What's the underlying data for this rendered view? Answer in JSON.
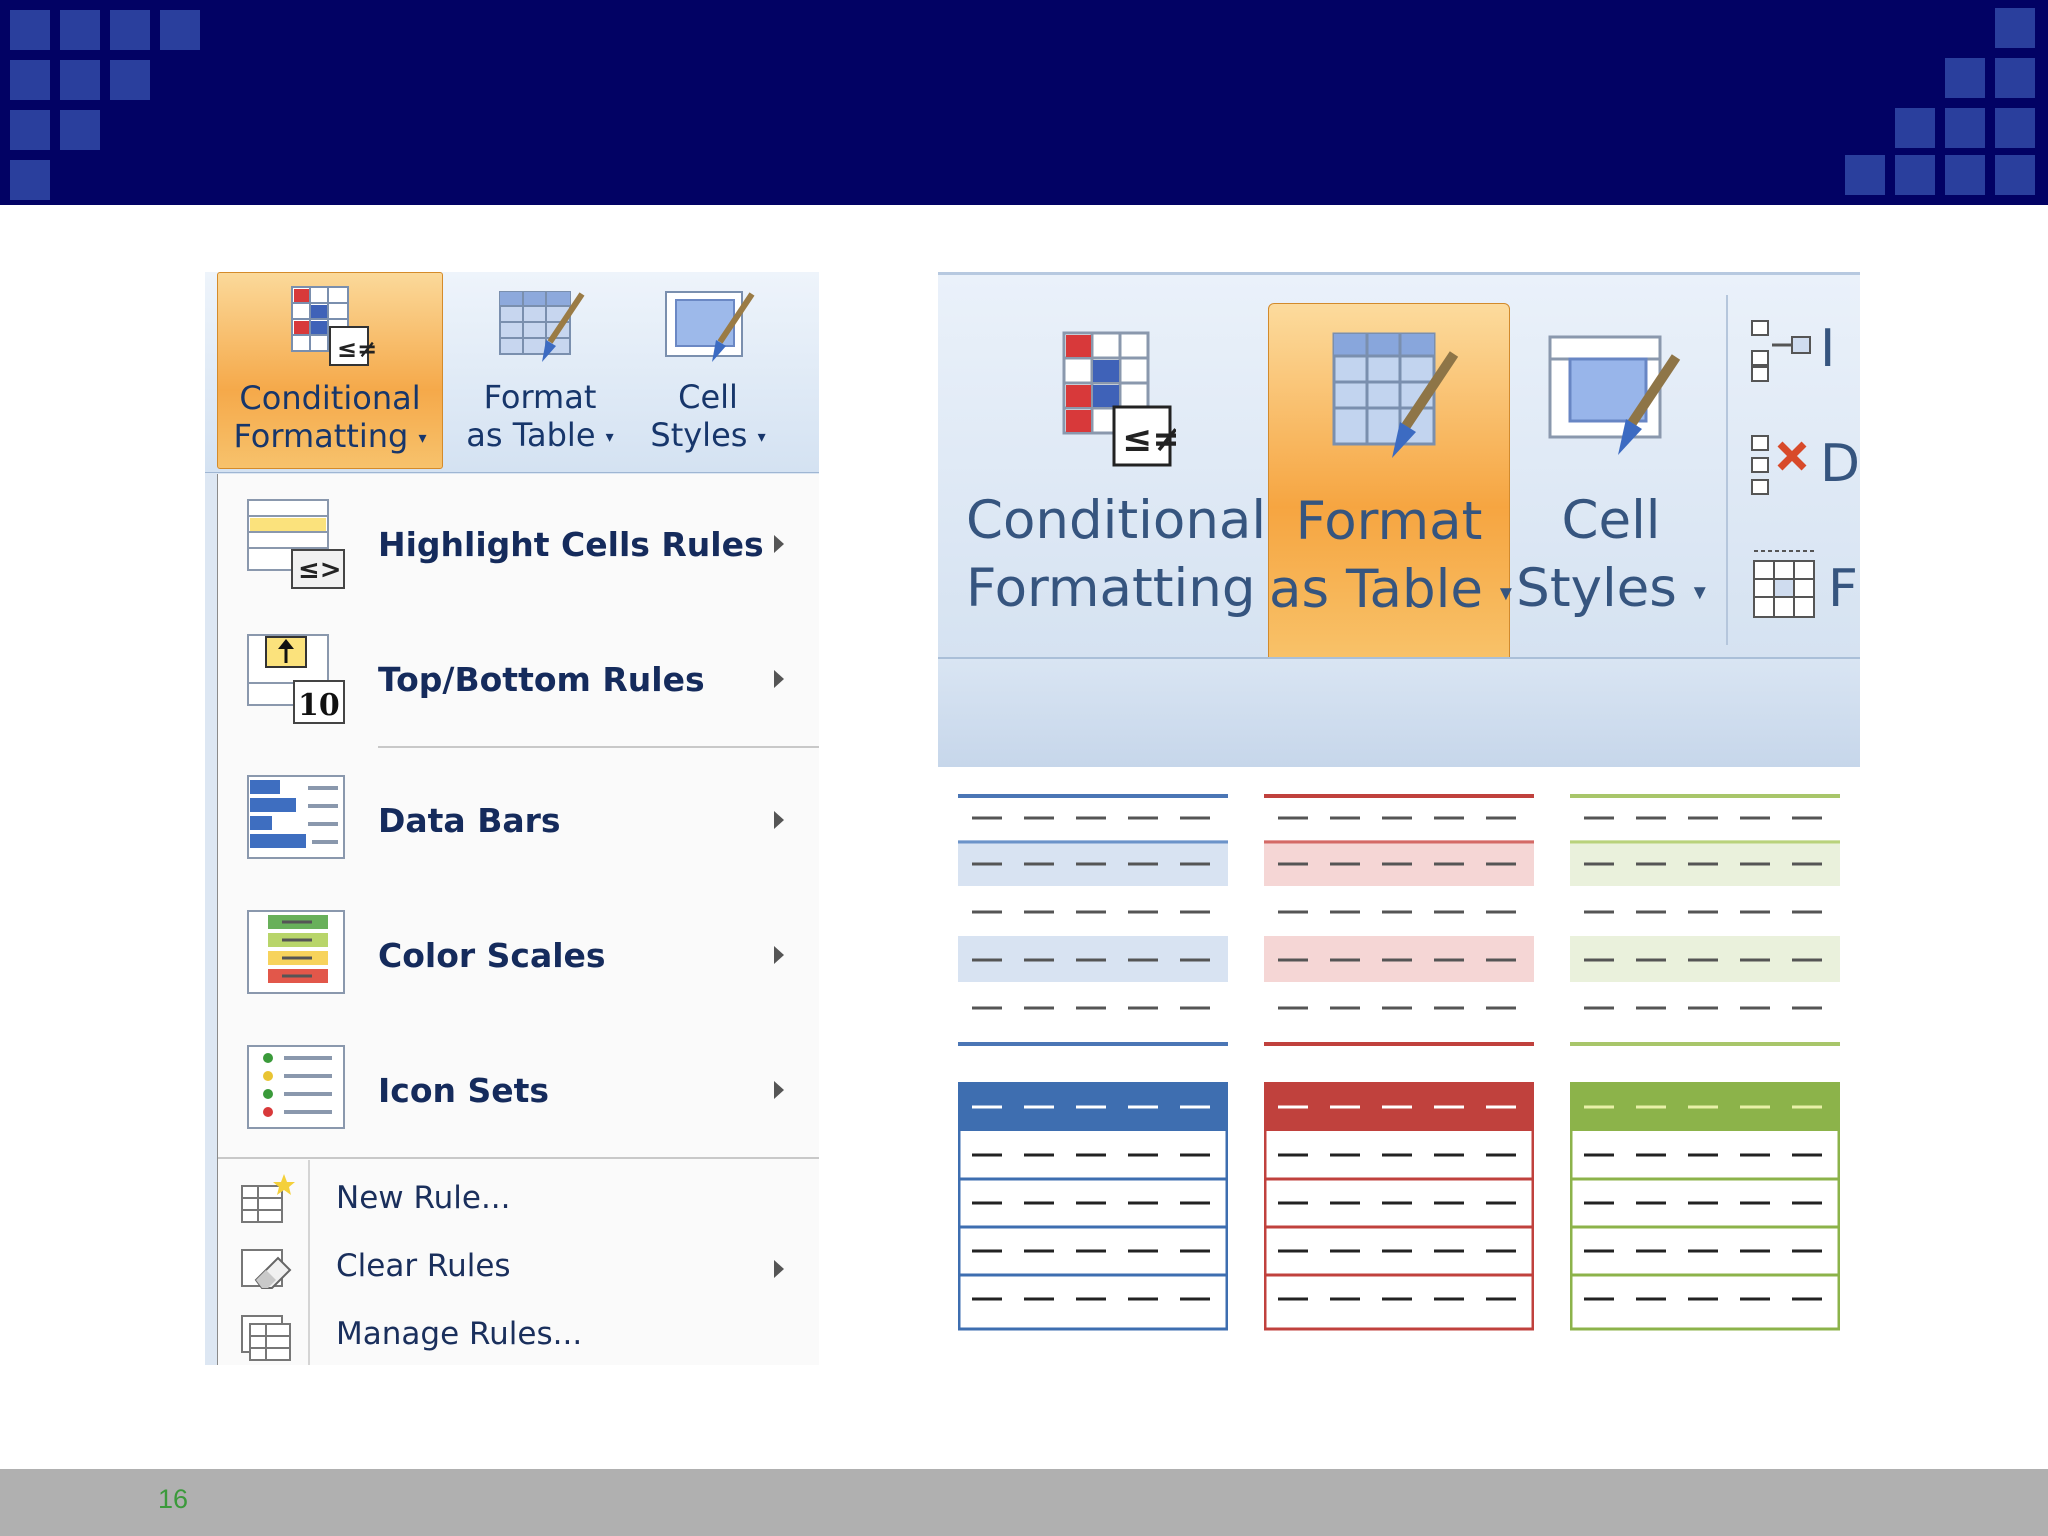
{
  "slide": {
    "page_number": "16"
  },
  "left_ribbon": {
    "conditional_formatting": {
      "line1": "Conditional",
      "line2": "Formatting"
    },
    "format_as_table": {
      "line1": "Format",
      "line2": "as Table"
    },
    "cell_styles": {
      "line1": "Cell",
      "line2": "Styles"
    }
  },
  "menu": {
    "items": [
      {
        "label": "Highlight Cells Rules",
        "icon": "highlight-cells-icon"
      },
      {
        "label": "Top/Bottom Rules",
        "icon": "top-bottom-icon"
      },
      {
        "label": "Data Bars",
        "icon": "data-bars-icon"
      },
      {
        "label": "Color Scales",
        "icon": "color-scales-icon"
      },
      {
        "label": "Icon Sets",
        "icon": "icon-sets-icon"
      }
    ],
    "small_items": [
      {
        "label": "New Rule...",
        "icon": "new-rule-icon"
      },
      {
        "label": "Clear Rules",
        "icon": "clear-rules-icon"
      },
      {
        "label": "Manage Rules...",
        "icon": "manage-rules-icon"
      }
    ],
    "top_bottom_badge": "10"
  },
  "right_ribbon": {
    "conditional_formatting": {
      "line1": "Conditional",
      "line2": "Formatting"
    },
    "format_as_table": {
      "line1": "Format",
      "line2": "as Table"
    },
    "cell_styles": {
      "line1": "Cell",
      "line2": "Styles"
    },
    "cut_off_labels": [
      "I",
      "D",
      "F"
    ]
  },
  "colors": {
    "header": "#020264",
    "header_squares": "#2a3f9d",
    "blue_style": "#3e6eb0",
    "red_style": "#c0413d",
    "green_style": "#8cb34a",
    "page_number": "#3b9a3b"
  }
}
